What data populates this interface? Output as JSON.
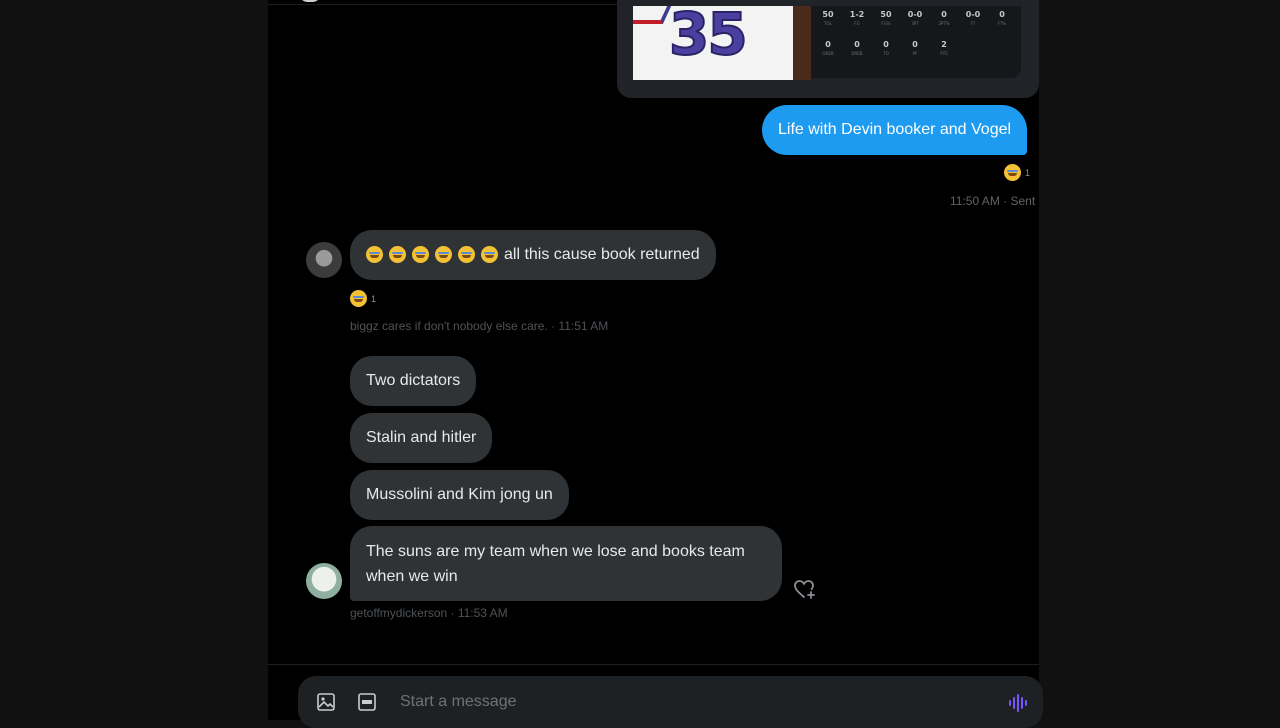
{
  "shared_card": {
    "jersey_number": "35",
    "stats_row1": [
      {
        "value": "50",
        "label": "TOL"
      },
      {
        "value": "1-2",
        "label": "FG"
      },
      {
        "value": "50",
        "label": "FG%"
      },
      {
        "value": "0-0",
        "label": "3PT"
      },
      {
        "value": "0",
        "label": "3PT%"
      },
      {
        "value": "0-0",
        "label": "FT"
      },
      {
        "value": "0",
        "label": "FT%"
      }
    ],
    "stats_row2": [
      {
        "value": "0",
        "label": "OREB"
      },
      {
        "value": "0",
        "label": "DREB"
      },
      {
        "value": "0",
        "label": "TO"
      },
      {
        "value": "0",
        "label": "PF"
      },
      {
        "value": "2",
        "label": "PTS"
      }
    ]
  },
  "messages": {
    "sent1": {
      "text": "Life with Devin booker and Vogel",
      "reaction_count": "1",
      "meta": "11:50 AM · Sent"
    },
    "recv1": {
      "text": "all this cause book returned",
      "emoji_count": 6,
      "reaction_count": "1",
      "meta": "biggz cares if don't nobody else care. · 11:51 AM"
    },
    "recv2": {
      "text": "Two dictators"
    },
    "recv3": {
      "text": "Stalin and hitler"
    },
    "recv4": {
      "text": "Mussolini and Kim jong un"
    },
    "recv5": {
      "text": "The suns are my team when we lose and books team when we win",
      "meta": "getoffmydickerson · 11:53 AM"
    }
  },
  "composer": {
    "placeholder": "Start a message"
  },
  "colors": {
    "sent_bubble": "#1d9bf0",
    "recv_bubble": "#2f3336",
    "background": "#000000",
    "voice_icon": "#7856ff"
  },
  "icons": [
    "image-icon",
    "gif-icon",
    "voice-message-icon",
    "add-reaction-heart-icon",
    "face-with-tears-of-joy-icon"
  ]
}
